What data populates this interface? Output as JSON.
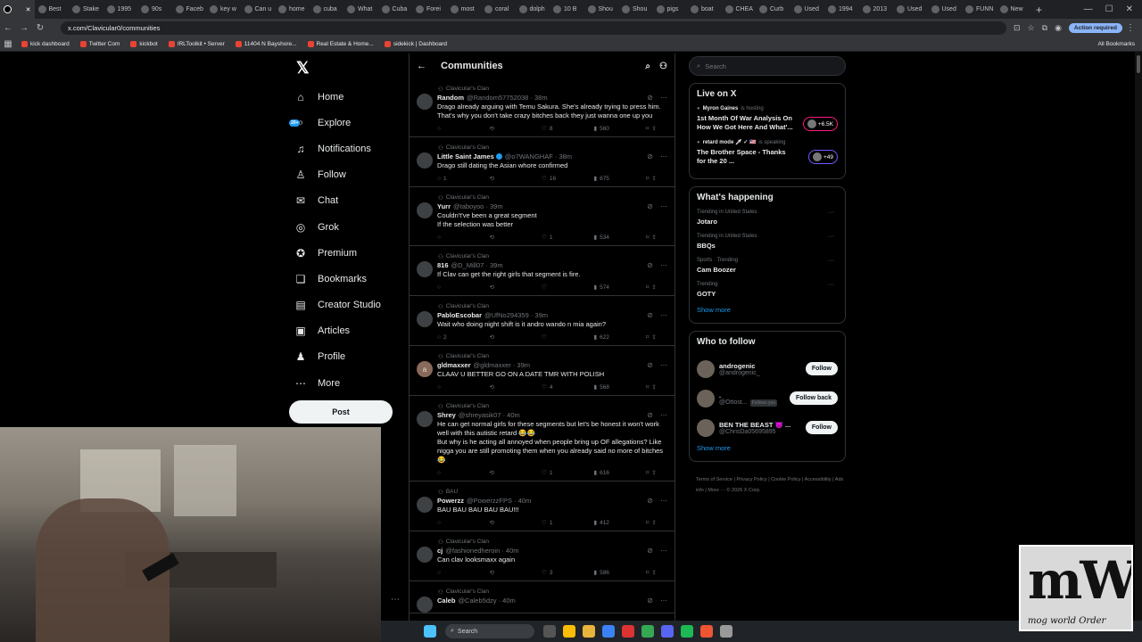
{
  "browser": {
    "tabs": [
      "Best",
      "Stake",
      "1995",
      "90s",
      "Faceb",
      "key w",
      "Can u",
      "home",
      "cuba",
      "What",
      "Cuba",
      "Forei",
      "most",
      "coral",
      "dolph",
      "10 B",
      "Shou",
      "Shou",
      "pigs",
      "boat",
      "CHEA",
      "Curb",
      "Used",
      "1994",
      "2013",
      "Used",
      "Used",
      "FUNN",
      "New"
    ],
    "new_tab": "+",
    "url": "x.com/Clavicular0/communities",
    "action_required": "Action required",
    "bookmarks": [
      "kick dashboard",
      "Twitter Com",
      "kickbot",
      "IRLToolkit • Server",
      "11404 N Bayshore...",
      "Real Estate & Home...",
      "sidekick | Dashboard"
    ],
    "all_bookmarks": "All Bookmarks"
  },
  "nav": {
    "logo": "𝕏",
    "items": [
      {
        "label": "Home",
        "icon": "⌂"
      },
      {
        "label": "Explore",
        "icon": "⌕"
      },
      {
        "label": "Notifications",
        "icon": "♫",
        "badge": "20+"
      },
      {
        "label": "Follow",
        "icon": "♙"
      },
      {
        "label": "Chat",
        "icon": "✉"
      },
      {
        "label": "Grok",
        "icon": "◎"
      },
      {
        "label": "Premium",
        "icon": "✪"
      },
      {
        "label": "Bookmarks",
        "icon": "❑"
      },
      {
        "label": "Creator Studio",
        "icon": "▤"
      },
      {
        "label": "Articles",
        "icon": "▣"
      },
      {
        "label": "Profile",
        "icon": "♟"
      },
      {
        "label": "More",
        "icon": "⋯"
      }
    ],
    "post": "Post"
  },
  "header": {
    "title": "Communities",
    "back": "←"
  },
  "posts": [
    {
      "community": "Clavicular's Clan",
      "name": "Random",
      "handle": "@Random57752038 · 38m",
      "text": "Drago already arguing with Temu Sakura. She's already trying to press him. That's why you don't take crazy bitches back they just wanna one up you",
      "reply": "",
      "retweet": "",
      "like": "8",
      "views": "560",
      "avatar": ""
    },
    {
      "community": "Clavicular's Clan",
      "name": "Little Saint James",
      "handle": "@o7WANGHAF · 38m",
      "text": "Drago still dating the Asian whore confirmed",
      "reply": "1",
      "retweet": "",
      "like": "16",
      "views": "675",
      "avatar": "",
      "verified": true
    },
    {
      "community": "Clavicular's Clan",
      "name": "Yurr",
      "handle": "@taboyoo · 39m",
      "text": "Couldn't've been a great segment\nIf the selection was better",
      "reply": "",
      "retweet": "",
      "like": "1",
      "views": "534",
      "avatar": ""
    },
    {
      "community": "Clavicular's Clan",
      "name": "816",
      "handle": "@D_Mill07 · 39m",
      "text": "If Clav can get the right girls that segment is fire.",
      "reply": "",
      "retweet": "",
      "like": "",
      "views": "574",
      "avatar": ""
    },
    {
      "community": "Clavicular's Clan",
      "name": "PabloEscobar",
      "handle": "@UfNo294359 · 39m",
      "text": "Wait who doing night shift is it andro wando n mia again?",
      "reply": "2",
      "retweet": "",
      "like": "",
      "views": "622",
      "avatar": ""
    },
    {
      "community": "Clavicular's Clan",
      "name": "gldmaxxer",
      "handle": "@gldmaxxer · 39m",
      "text": "CLAAV U BETTER GO ON A DATE TMR WITH POLISH",
      "reply": "",
      "retweet": "",
      "like": "4",
      "views": "568",
      "avatar": "a"
    },
    {
      "community": "Clavicular's Clan",
      "name": "Shrey",
      "handle": "@shreyasik07 · 40m",
      "text": "He can get normal girls for these segments but let's be honest it won't work well with this autistic retard 😂😂\nBut why is he acting all annoyed when people bring up OF allegations? Like nigga you are still promoting them when you already said no more of bitches 😂",
      "reply": "",
      "retweet": "",
      "like": "1",
      "views": "616",
      "avatar": ""
    },
    {
      "community": "BAU",
      "name": "Powerzz",
      "handle": "@PowerzzFPS · 40m",
      "text": "BAU BAU BAU BAU BAU!!!",
      "reply": "",
      "retweet": "",
      "like": "1",
      "views": "412",
      "avatar": ""
    },
    {
      "community": "Clavicular's Clan",
      "name": "cj",
      "handle": "@fashionedheroin · 40m",
      "text": "Can clav looksmaxx again",
      "reply": "",
      "retweet": "",
      "like": "3",
      "views": "586",
      "avatar": ""
    },
    {
      "community": "Clavicular's Clan",
      "name": "Caleb",
      "handle": "@Caleb5dzy · 40m",
      "text": "",
      "reply": "",
      "retweet": "",
      "like": "",
      "views": "",
      "avatar": ""
    }
  ],
  "right": {
    "search_placeholder": "Search",
    "live_title": "Live on X",
    "live": [
      {
        "host": "Myron Gaines",
        "status": "is hosting",
        "title": "1st Month Of War Analysis On How We Got Here And What'...",
        "count": "+6.5K"
      },
      {
        "host": "retard mode 🗡 ✓ 🇺🇸",
        "status": "is speaking",
        "title": "The Brother Space - Thanks for the 20 ...",
        "count": "+49"
      }
    ],
    "happening_title": "What's happening",
    "trends": [
      {
        "context": "Trending in United States",
        "name": "Jotaro"
      },
      {
        "context": "Trending in United States",
        "name": "BBQs"
      },
      {
        "context": "Sports · Trending",
        "name": "Cam Boozer"
      },
      {
        "context": "Trending",
        "name": "GOTY"
      }
    ],
    "show_more": "Show more",
    "wtf_title": "Who to follow",
    "follow": [
      {
        "name": "androgenic",
        "handle": "@androgenic_",
        "button": "Follow",
        "follows_you": ""
      },
      {
        "name": ".",
        "handle": "@Ottost...",
        "button": "Follow back",
        "follows_you": "Follows you"
      },
      {
        "name": "BEN THE BEAST 😈 ...",
        "handle": "@ChrisDa05695895",
        "button": "Follow",
        "follows_you": ""
      }
    ],
    "footer": "Terms of Service  |  Privacy Policy  |  Cookie Policy  |  Accessibility  |  Ads info  |  More ···  © 2026 X Corp."
  },
  "taskbar": {
    "search": "Search"
  },
  "overlay": {
    "logo_big": "mWo",
    "logo_small": "mog world Order"
  }
}
